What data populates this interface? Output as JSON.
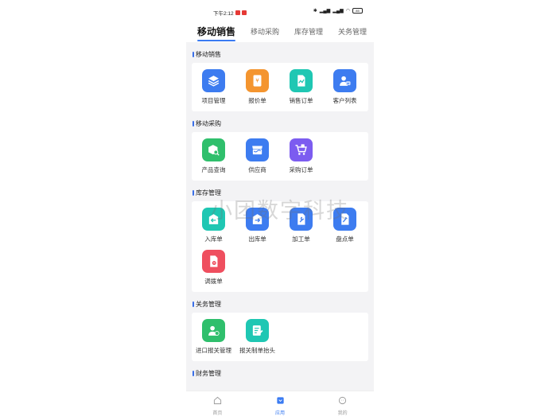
{
  "status": {
    "time": "下午2:12",
    "battery": "85"
  },
  "tabs": [
    "移动销售",
    "移动采购",
    "库存管理",
    "关务管理"
  ],
  "sections": [
    {
      "title": "移动销售",
      "items": [
        {
          "label": "项目管理",
          "icon": "layers-icon",
          "color": "#3d7cf0"
        },
        {
          "label": "报价单",
          "icon": "yen-document-icon",
          "color": "#f4952f"
        },
        {
          "label": "销售订单",
          "icon": "chart-document-icon",
          "color": "#1fc7b3"
        },
        {
          "label": "客户列表",
          "icon": "user-card-icon",
          "color": "#3d7cf0"
        }
      ]
    },
    {
      "title": "移动采购",
      "items": [
        {
          "label": "产品查询",
          "icon": "box-search-icon",
          "color": "#2fbf6c"
        },
        {
          "label": "供应商",
          "icon": "store-icon",
          "color": "#3d7cf0"
        },
        {
          "label": "采购订单",
          "icon": "cart-icon",
          "color": "#7c5cf0"
        }
      ]
    },
    {
      "title": "库存管理",
      "items": [
        {
          "label": "入库单",
          "icon": "inbound-icon",
          "color": "#1fc7b3"
        },
        {
          "label": "出库单",
          "icon": "outbound-icon",
          "color": "#3d7cf0"
        },
        {
          "label": "加工单",
          "icon": "wrench-document-icon",
          "color": "#3d7cf0"
        },
        {
          "label": "盘点单",
          "icon": "check-document-icon",
          "color": "#3d7cf0"
        },
        {
          "label": "调拨单",
          "icon": "transfer-document-icon",
          "color": "#ef4f5f"
        }
      ]
    },
    {
      "title": "关务管理",
      "items": [
        {
          "label": "进口报关管理",
          "icon": "user-import-icon",
          "color": "#2fbf6c"
        },
        {
          "label": "报关制单抬头",
          "icon": "edit-list-icon",
          "color": "#1fc7b3"
        }
      ]
    },
    {
      "title": "财务管理",
      "items": []
    }
  ],
  "watermark": "小团数字科技",
  "bottom_nav": [
    {
      "label": "首页",
      "icon": "home-icon",
      "active": false
    },
    {
      "label": "应用",
      "icon": "apps-icon",
      "active": true
    },
    {
      "label": "我的",
      "icon": "profile-icon",
      "active": false
    }
  ]
}
